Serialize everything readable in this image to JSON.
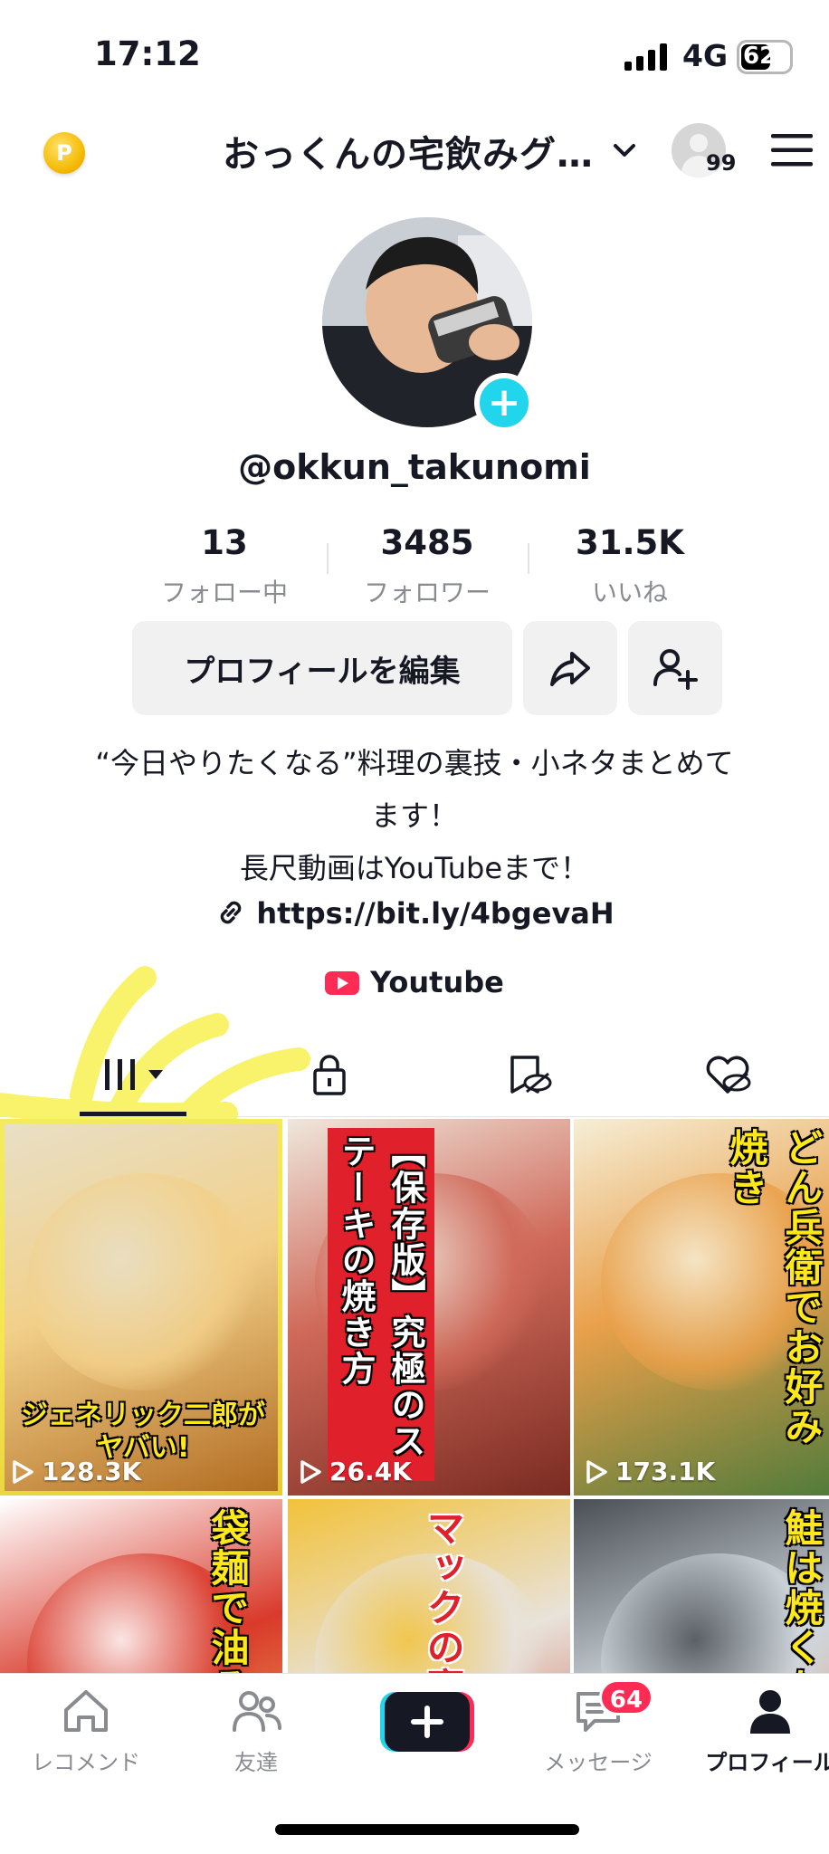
{
  "status_bar": {
    "time": "17:12",
    "network": "4G",
    "battery": "62",
    "battery_level": 0.62
  },
  "header": {
    "title": "おっくんの宅飲みグ…",
    "notification_count": "99",
    "coin_label": "P"
  },
  "profile": {
    "handle": "@okkun_takunomi",
    "stats": [
      {
        "value": "13",
        "label": "フォロー中"
      },
      {
        "value": "3485",
        "label": "フォロワー"
      },
      {
        "value": "31.5K",
        "label": "いいね"
      }
    ],
    "edit_button": "プロフィールを編集",
    "bio_lines": [
      "“今日やりたくなる”料理の裏技・小ネタまとめて",
      "ます！",
      "長尺動画はYouTubeまで！"
    ],
    "link": "https://bit.ly/4bgevaH",
    "youtube_label": "Youtube"
  },
  "videos": [
    {
      "caption": "ジェネリック二郎が\nヤバい!",
      "views": "128.3K",
      "colors": [
        "#f2d08a",
        "#b06a1f",
        "#e8e0c8"
      ]
    },
    {
      "caption": "【保存版】究極のステーキの焼き方",
      "views": "26.4K",
      "colors": [
        "#d06a5a",
        "#7a2b22",
        "#efe7dd"
      ]
    },
    {
      "caption": "どん兵衛でお好み焼き",
      "views": "173.1K",
      "colors": [
        "#e9a04a",
        "#4c7a3a",
        "#f6eed6"
      ]
    },
    {
      "caption": "袋麺で油そば",
      "views": "",
      "colors": [
        "#d93a2b",
        "#f2d36b",
        "#ffffff"
      ]
    },
    {
      "caption": "マックの裏",
      "views": "",
      "colors": [
        "#e8e2da",
        "#c43a26",
        "#f2c23a"
      ]
    },
    {
      "caption": "鮭は焼くな茹でた",
      "views": "",
      "colors": [
        "#cfd6dc",
        "#f08a5a",
        "#4a4f56"
      ]
    }
  ],
  "nav": {
    "items": [
      {
        "label": "レコメンド"
      },
      {
        "label": "友達"
      },
      {
        "label": ""
      },
      {
        "label": "メッセージ"
      },
      {
        "label": "プロフィール"
      }
    ],
    "message_badge": "64"
  },
  "colors": {
    "accent_cyan": "#20d5ec",
    "accent_red": "#fe2c55",
    "text": "#161823",
    "muted": "#8a8b91"
  }
}
